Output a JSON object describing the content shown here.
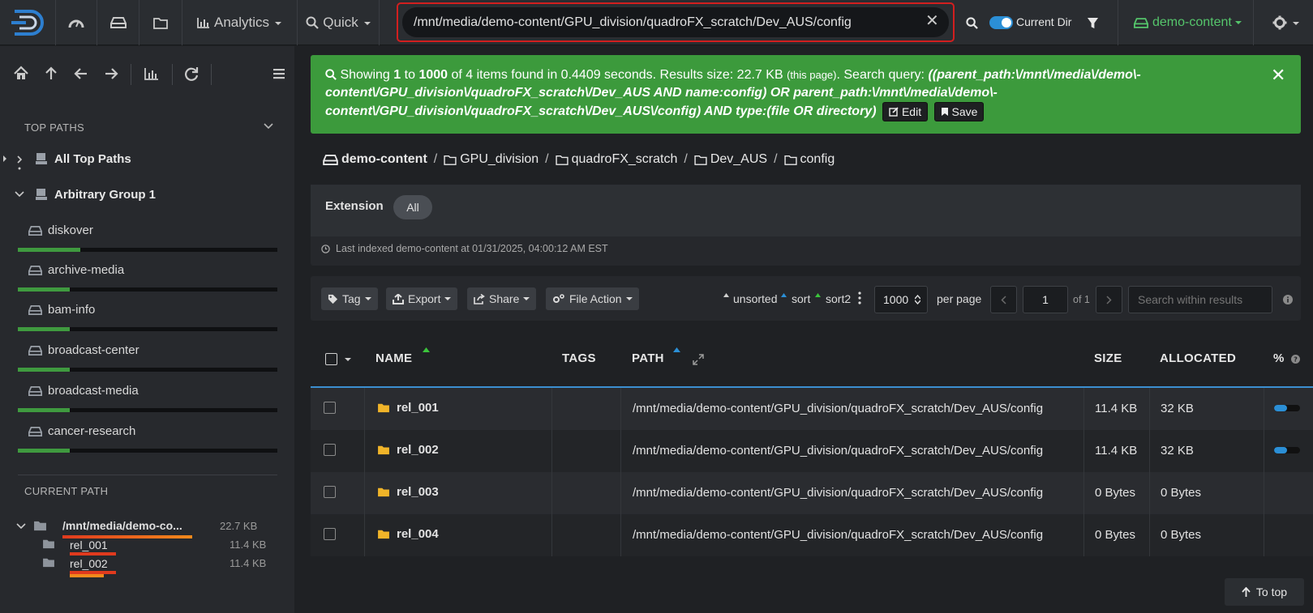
{
  "navbar": {
    "analytics_label": "Analytics",
    "quick_label": "Quick",
    "path_value": "/mnt/media/demo-content/GPU_division/quadroFX_scratch/Dev_AUS/config",
    "current_dir_label": "Current Dir",
    "current_dir_on": true,
    "workspace_label": "demo-content"
  },
  "sidebar": {
    "top_paths_heading": "TOP PATHS",
    "all_top_paths": "All Top Paths",
    "group_label": "Arbitrary Group 1",
    "items": [
      {
        "label": "diskover",
        "usage": 0.24
      },
      {
        "label": "archive-media",
        "usage": 0.2
      },
      {
        "label": "bam-info",
        "usage": 0.2
      },
      {
        "label": "broadcast-center",
        "usage": 0.2
      },
      {
        "label": "broadcast-media",
        "usage": 0.2
      },
      {
        "label": "cancer-research",
        "usage": 0.2
      }
    ],
    "current_path_heading": "CURRENT PATH",
    "current_path": {
      "label": "/mnt/media/demo-co...",
      "size": "22.7 KB"
    },
    "current_children": [
      {
        "label": "rel_001",
        "size": "11.4 KB"
      },
      {
        "label": "rel_002",
        "size": "11.4 KB"
      }
    ]
  },
  "alert": {
    "showing": "Showing",
    "from": "1",
    "to_word": "to",
    "to": "1000",
    "rest": "of 4 items found in 0.4409 seconds. Results size: 22.7 KB",
    "this_page": "(this page)",
    "query_label": ". Search query:",
    "query": "((parent_path:\\/mnt\\/media\\/demo\\-content\\/GPU_division\\/quadroFX_scratch\\/Dev_AUS AND name:config) OR parent_path:\\/mnt\\/media\\/demo\\-content\\/GPU_division\\/quadroFX_scratch\\/Dev_AUS\\/config) AND type:(file OR directory)",
    "edit_label": "Edit",
    "save_label": "Save"
  },
  "breadcrumb": {
    "root": "demo-content",
    "parts": [
      "GPU_division",
      "quadroFX_scratch",
      "Dev_AUS",
      "config"
    ]
  },
  "filters": {
    "extension_label": "Extension",
    "extension_chip": "All",
    "indexed_text": "Last indexed demo-content at 01/31/2025, 04:00:12 AM EST"
  },
  "toolbar": {
    "tag_label": "Tag",
    "export_label": "Export",
    "share_label": "Share",
    "file_action_label": "File Action",
    "unsorted_label": "unsorted",
    "sort_label": "sort",
    "sort2_label": "sort2",
    "per_page_value": "1000",
    "per_page_label": "per page",
    "page_value": "1",
    "page_of": "of 1",
    "search_placeholder": "Search within results"
  },
  "table": {
    "headers": {
      "name": "NAME",
      "tags": "TAGS",
      "path": "PATH",
      "size": "SIZE",
      "allocated": "ALLOCATED",
      "pct": "%"
    },
    "rows": [
      {
        "name": "rel_001",
        "path": "/mnt/media/demo-content/GPU_division/quadroFX_scratch/Dev_AUS/config",
        "size": "11.4 KB",
        "allocated": "32 KB",
        "pct": 0.5
      },
      {
        "name": "rel_002",
        "path": "/mnt/media/demo-content/GPU_division/quadroFX_scratch/Dev_AUS/config",
        "size": "11.4 KB",
        "allocated": "32 KB",
        "pct": 0.5
      },
      {
        "name": "rel_003",
        "path": "/mnt/media/demo-content/GPU_division/quadroFX_scratch/Dev_AUS/config",
        "size": "0 Bytes",
        "allocated": "0 Bytes",
        "pct": null
      },
      {
        "name": "rel_004",
        "path": "/mnt/media/demo-content/GPU_division/quadroFX_scratch/Dev_AUS/config",
        "size": "0 Bytes",
        "allocated": "0 Bytes",
        "pct": null
      }
    ]
  },
  "to_top_label": "To top",
  "colors": {
    "accent": "#2b8fd6",
    "success": "#3c9a3c",
    "highlight": "#d21f1f",
    "folder": "#f0b429",
    "workspace": "#55c56b"
  }
}
